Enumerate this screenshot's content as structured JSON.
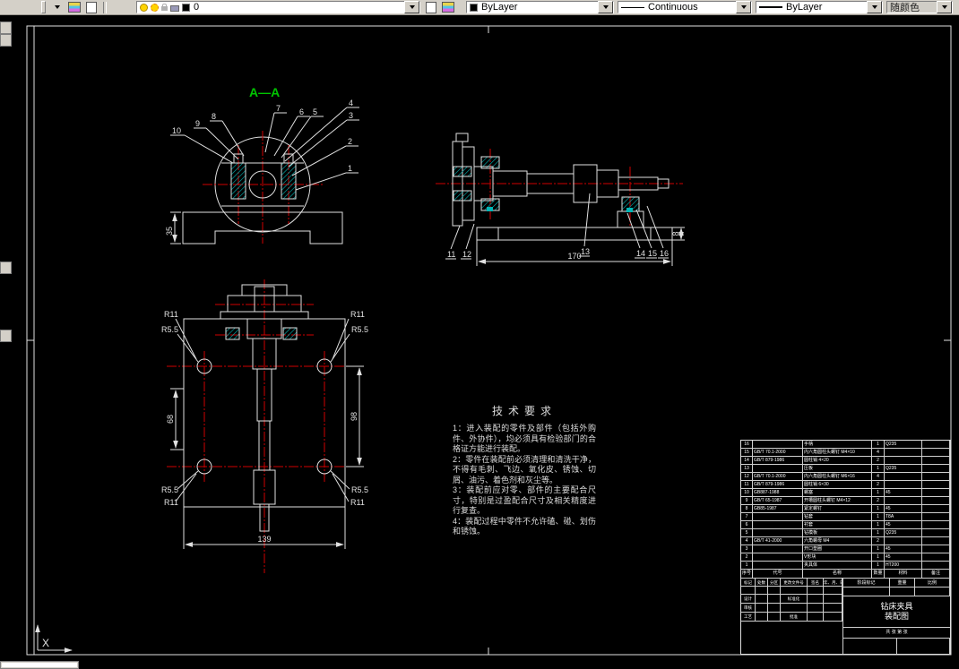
{
  "toolbar": {
    "layer_value": "0",
    "color_value": "ByLayer",
    "linetype_value": "Continuous",
    "lineweight_value": "ByLayer",
    "plotstyle_value": "随颜色"
  },
  "colors": {
    "line": "#e0e0e0",
    "centerline": "#d00000",
    "hatch": "#00b6b6",
    "section_label": "#00c400",
    "toolbar_bg": "#d4d0c8"
  },
  "drawing": {
    "section_label": "A—A",
    "balloons_aa": [
      "1",
      "2",
      "3",
      "4",
      "5",
      "6",
      "7",
      "8",
      "9",
      "10"
    ],
    "balloons_side": [
      "11",
      "12",
      "13",
      "14",
      "15",
      "16"
    ],
    "dims": {
      "d35": "35",
      "d170": "170",
      "d8": "8",
      "d139": "139",
      "d68": "68",
      "d98": "98",
      "r11": "R11",
      "r55": "R5.5"
    }
  },
  "tech": {
    "title": "技术要求",
    "items": [
      "1：进入装配的零件及部件（包括外购件、外协件），均必须具有检验部门的合格证方能进行装配。",
      "2：零件在装配前必须清理和清洗干净，不得有毛刺、飞边、氧化皮、锈蚀、切屑、油污、着色剂和灰尘等。",
      "3：装配前应对零、部件的主要配合尺寸，特别是过盈配合尺寸及相关精度进行复查。",
      "4：装配过程中零件不允许磕、碰、划伤和锈蚀。"
    ]
  },
  "title_block": {
    "parts_header": [
      "序号",
      "代号",
      "名称",
      "数量",
      "材料",
      "备注"
    ],
    "parts_rows": [
      {
        "no": "16",
        "code": "",
        "name": "手柄",
        "qty": "1",
        "mat": "Q235",
        "note": ""
      },
      {
        "no": "15",
        "code": "GB/T 70.1-2000",
        "name": "内六角圆柱头螺钉 M4×10",
        "qty": "4",
        "mat": "",
        "note": ""
      },
      {
        "no": "14",
        "code": "GB/T 879-1986",
        "name": "圆柱销 4×20",
        "qty": "2",
        "mat": "",
        "note": ""
      },
      {
        "no": "13",
        "code": "",
        "name": "压板",
        "qty": "1",
        "mat": "Q235",
        "note": ""
      },
      {
        "no": "12",
        "code": "GB/T 70.1-2000",
        "name": "内六角圆柱头螺钉 M6×16",
        "qty": "4",
        "mat": "",
        "note": ""
      },
      {
        "no": "11",
        "code": "GB/T 879-1986",
        "name": "圆柱销 6×30",
        "qty": "2",
        "mat": "",
        "note": ""
      },
      {
        "no": "10",
        "code": "GB887-1988",
        "name": "螺塞",
        "qty": "1",
        "mat": "45",
        "note": ""
      },
      {
        "no": "9",
        "code": "GB/T 65-1987",
        "name": "开槽圆柱头螺钉 M4×12",
        "qty": "2",
        "mat": "",
        "note": ""
      },
      {
        "no": "8",
        "code": "GB85-1987",
        "name": "紧定螺钉",
        "qty": "1",
        "mat": "45",
        "note": ""
      },
      {
        "no": "7",
        "code": "",
        "name": "钻套",
        "qty": "1",
        "mat": "T8A",
        "note": ""
      },
      {
        "no": "6",
        "code": "",
        "name": "衬套",
        "qty": "1",
        "mat": "45",
        "note": ""
      },
      {
        "no": "5",
        "code": "",
        "name": "钻模板",
        "qty": "1",
        "mat": "Q235",
        "note": ""
      },
      {
        "no": "4",
        "code": "GB/T 41-2000",
        "name": "六角螺母 M4",
        "qty": "2",
        "mat": "",
        "note": ""
      },
      {
        "no": "3",
        "code": "",
        "name": "开口垫圈",
        "qty": "1",
        "mat": "45",
        "note": ""
      },
      {
        "no": "2",
        "code": "",
        "name": "V形块",
        "qty": "1",
        "mat": "45",
        "note": ""
      },
      {
        "no": "1",
        "code": "",
        "name": "夹具体",
        "qty": "1",
        "mat": "HT200",
        "note": ""
      }
    ],
    "rev_row": [
      "标记",
      "处数",
      "分区",
      "更改文件号",
      "签名",
      "年、月、日"
    ],
    "sign_cells": [
      "设计",
      "",
      "",
      "标准化",
      "",
      "",
      "审核",
      "",
      "",
      "",
      "",
      "",
      "工艺",
      "",
      "",
      "批准",
      "",
      ""
    ],
    "stage_label": "阶段标记",
    "weight_label": "重量",
    "scale_label": "比例",
    "sheet_label": "共 张 第 张",
    "title_lines": [
      "钻床夹具",
      "装配图"
    ]
  },
  "ucs": {
    "x_label": "X"
  }
}
